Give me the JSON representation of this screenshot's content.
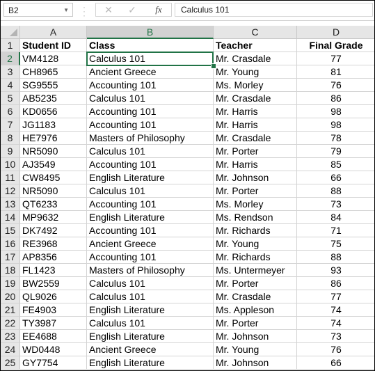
{
  "formula_bar": {
    "name_box": "B2",
    "cancel_icon": "✕",
    "enter_icon": "✓",
    "function_icon": "fx",
    "content": "Calculus 101"
  },
  "sheet": {
    "columns": [
      "A",
      "B",
      "C",
      "D"
    ],
    "selected_column": "B",
    "selected_row": 2,
    "headers": [
      "Student ID",
      "Class",
      "Teacher",
      "Final Grade"
    ],
    "rows": [
      [
        "VM4128",
        "Calculus 101",
        "Mr. Crasdale",
        "77"
      ],
      [
        "CH8965",
        "Ancient Greece",
        "Mr. Young",
        "81"
      ],
      [
        "SG9555",
        "Accounting 101",
        "Ms. Morley",
        "76"
      ],
      [
        "AB5235",
        "Calculus 101",
        "Mr. Crasdale",
        "86"
      ],
      [
        "KD0656",
        "Accounting 101",
        "Mr. Harris",
        "98"
      ],
      [
        "JG1183",
        "Accounting 101",
        "Mr. Harris",
        "98"
      ],
      [
        "HE7976",
        "Masters of Philosophy",
        "Mr. Crasdale",
        "78"
      ],
      [
        "NR5090",
        "Calculus 101",
        "Mr. Porter",
        "79"
      ],
      [
        "AJ3549",
        "Accounting 101",
        "Mr. Harris",
        "85"
      ],
      [
        "CW8495",
        "English Literature",
        "Mr. Johnson",
        "66"
      ],
      [
        "NR5090",
        "Calculus 101",
        "Mr. Porter",
        "88"
      ],
      [
        "QT6233",
        "Accounting 101",
        "Ms. Morley",
        "73"
      ],
      [
        "MP9632",
        "English Literature",
        "Ms. Rendson",
        "84"
      ],
      [
        "DK7492",
        "Accounting 101",
        "Mr. Richards",
        "71"
      ],
      [
        "RE3968",
        "Ancient Greece",
        "Mr. Young",
        "75"
      ],
      [
        "AP8356",
        "Accounting 101",
        "Mr. Richards",
        "88"
      ],
      [
        "FL1423",
        "Masters of Philosophy",
        "Ms. Untermeyer",
        "93"
      ],
      [
        "BW2559",
        "Calculus 101",
        "Mr. Porter",
        "86"
      ],
      [
        "QL9026",
        "Calculus 101",
        "Mr. Crasdale",
        "77"
      ],
      [
        "FE4903",
        "English Literature",
        "Ms. Appleson",
        "74"
      ],
      [
        "TY3987",
        "Calculus 101",
        "Mr. Porter",
        "74"
      ],
      [
        "EE4688",
        "English Literature",
        "Mr. Johnson",
        "73"
      ],
      [
        "WD0448",
        "Ancient Greece",
        "Mr. Young",
        "76"
      ],
      [
        "GY7754",
        "English Literature",
        "Mr. Johnson",
        "66"
      ]
    ]
  },
  "colors": {
    "accent": "#217346",
    "header_bg": "#e6e6e6",
    "header_selected_bg": "#d2d2d2",
    "gridline": "#d4d4d4"
  }
}
